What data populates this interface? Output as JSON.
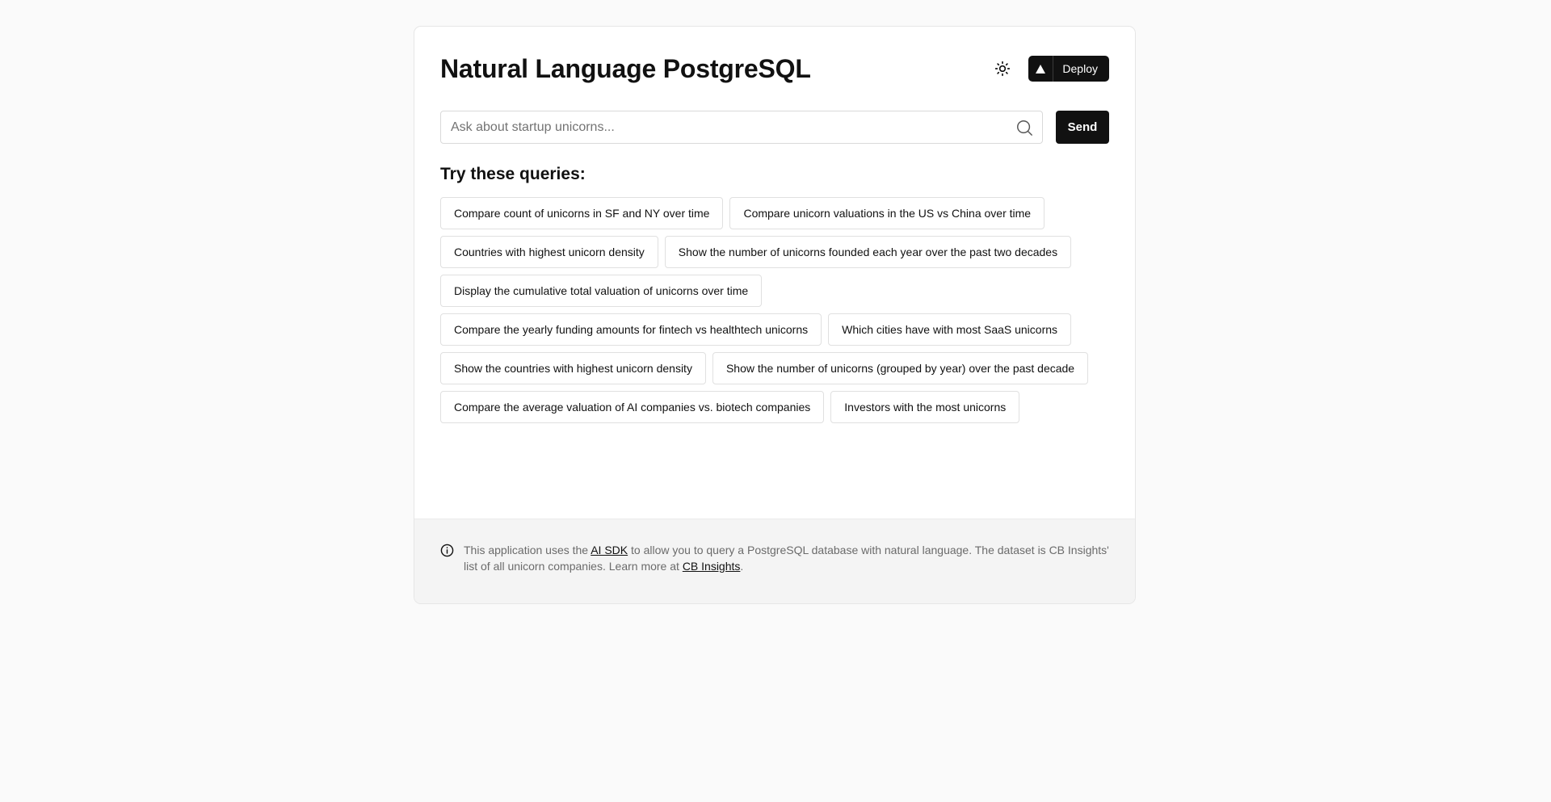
{
  "header": {
    "title": "Natural Language PostgreSQL",
    "theme_toggle_icon": "sun-icon",
    "deploy_label": "Deploy",
    "deploy_icon": "triangle-icon"
  },
  "search": {
    "placeholder": "Ask about startup unicorns...",
    "value": "",
    "icon": "search-icon",
    "send_label": "Send"
  },
  "queries": {
    "heading": "Try these queries:",
    "items": [
      "Compare count of unicorns in SF and NY over time",
      "Compare unicorn valuations in the US vs China over time",
      "Countries with highest unicorn density",
      "Show the number of unicorns founded each year over the past two decades",
      "Display the cumulative total valuation of unicorns over time",
      "Compare the yearly funding amounts for fintech vs healthtech unicorns",
      "Which cities have with most SaaS unicorns",
      "Show the countries with highest unicorn density",
      "Show the number of unicorns (grouped by year) over the past decade",
      "Compare the average valuation of AI companies vs. biotech companies",
      "Investors with the most unicorns"
    ]
  },
  "footer": {
    "icon": "info-icon",
    "text_before": "This application uses the ",
    "link_sdk": "AI SDK",
    "text_middle": " to allow you to query a PostgreSQL database with natural language. The dataset is CB Insights' list of all unicorn companies. Learn more at ",
    "link_cb": "CB Insights",
    "text_after": "."
  },
  "colors": {
    "page_bg": "#fafafa",
    "card_bg": "#ffffff",
    "footer_bg": "#f4f4f4",
    "primary": "#111111",
    "muted_text": "#6b6b6b"
  }
}
